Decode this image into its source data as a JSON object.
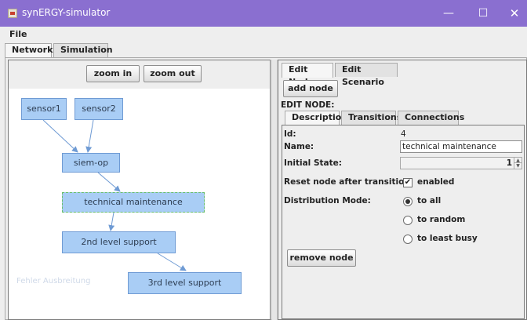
{
  "window": {
    "title": "synERGY-simulator",
    "minimize": "—",
    "maximize": "☐",
    "close": "✕"
  },
  "menu": {
    "file": "File"
  },
  "main_tabs": [
    {
      "label": "Network"
    },
    {
      "label": "Simulation"
    }
  ],
  "network": {
    "zoom_in": "zoom in",
    "zoom_out": "zoom out",
    "nodes": {
      "sensor1": "sensor1",
      "sensor2": "sensor2",
      "siem_op": "siem-op",
      "technical_maintenance": "technical maintenance",
      "second_level_support": "2nd level support",
      "third_level_support": "3rd level support"
    },
    "ghost_label": "Fehler Ausbreitung"
  },
  "editor": {
    "tabs": [
      {
        "label": "Edit Node"
      },
      {
        "label": "Edit Scenario"
      }
    ],
    "add_node": "add node",
    "section_title": "EDIT NODE:",
    "sub_tabs": [
      {
        "label": "Description"
      },
      {
        "label": "Transitions"
      },
      {
        "label": "Connections"
      }
    ],
    "id_label": "Id:",
    "id_value": "4",
    "name_label": "Name:",
    "name_value": "technical maintenance",
    "initial_state_label": "Initial State:",
    "initial_state_value": "1",
    "reset_label": "Reset node after transition:",
    "reset_checked": true,
    "reset_option": "enabled",
    "distribution_label": "Distribution Mode:",
    "distribution_options": [
      "to all",
      "to random",
      "to least busy"
    ],
    "distribution_selected": "to all",
    "remove_node": "remove node"
  },
  "colors": {
    "titlebar": "#8a6fd0",
    "node_fill": "#a9cdf5",
    "node_border": "#6f9bd4",
    "edge": "#6f9bd4"
  }
}
